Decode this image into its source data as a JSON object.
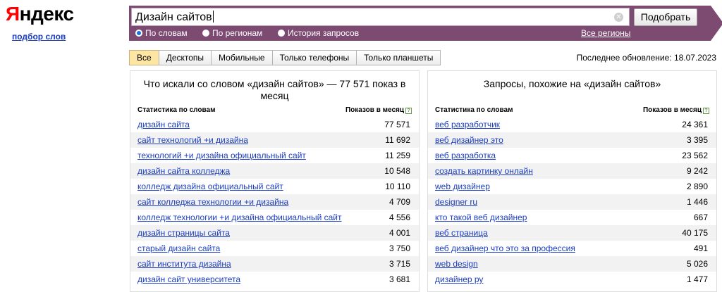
{
  "logo": {
    "first": "Я",
    "rest": "ндекс"
  },
  "service_link": "подбор слов",
  "search": {
    "value": "Дизайн сайтов",
    "button": "Подобрать"
  },
  "radios": [
    {
      "label": "По словам",
      "selected": true
    },
    {
      "label": "По регионам",
      "selected": false
    },
    {
      "label": "История запросов",
      "selected": false
    }
  ],
  "regions_link": "Все регионы",
  "tabs": [
    {
      "label": "Все",
      "active": true
    },
    {
      "label": "Десктопы",
      "active": false
    },
    {
      "label": "Мобильные",
      "active": false
    },
    {
      "label": "Только телефоны",
      "active": false
    },
    {
      "label": "Только планшеты",
      "active": false
    }
  ],
  "updated": "Последнее обновление: 18.07.2023",
  "left": {
    "title": "Что искали со словом «дизайн сайтов» — 77 571 показ в месяц",
    "col1": "Статистика по словам",
    "col2": "Показов в месяц",
    "rows": [
      {
        "kw": "дизайн сайта",
        "n": "77 571"
      },
      {
        "kw": "сайт технологий +и дизайна",
        "n": "11 692"
      },
      {
        "kw": "технологий +и дизайна официальный сайт",
        "n": "11 259"
      },
      {
        "kw": "дизайн сайта колледжа",
        "n": "10 548"
      },
      {
        "kw": "колледж дизайна официальный сайт",
        "n": "10 110"
      },
      {
        "kw": "сайт колледжа технологии +и дизайна",
        "n": "4 709"
      },
      {
        "kw": "колледж технологии +и дизайна официальный сайт",
        "n": "4 556"
      },
      {
        "kw": "дизайн страницы сайта",
        "n": "4 001"
      },
      {
        "kw": "старый дизайн сайта",
        "n": "3 750"
      },
      {
        "kw": "сайт института дизайна",
        "n": "3 715"
      },
      {
        "kw": "дизайн сайт университета",
        "n": "3 681"
      }
    ]
  },
  "right": {
    "title": "Запросы, похожие на «дизайн сайтов»",
    "col1": "Статистика по словам",
    "col2": "Показов в месяц",
    "rows": [
      {
        "kw": "веб разработчик",
        "n": "24 361"
      },
      {
        "kw": "веб дизайнер это",
        "n": "3 395"
      },
      {
        "kw": "веб разработка",
        "n": "23 562"
      },
      {
        "kw": "создать картинку онлайн",
        "n": "9 242"
      },
      {
        "kw": "web дизайнер",
        "n": "2 890"
      },
      {
        "kw": "designer ru",
        "n": "1 446"
      },
      {
        "kw": "кто такой веб дизайнер",
        "n": "667"
      },
      {
        "kw": "веб страница",
        "n": "40 175"
      },
      {
        "kw": "веб дизайнер что это за профессия",
        "n": "491"
      },
      {
        "kw": "web design",
        "n": "5 026"
      },
      {
        "kw": "дизайнер ру",
        "n": "1 477"
      }
    ]
  }
}
